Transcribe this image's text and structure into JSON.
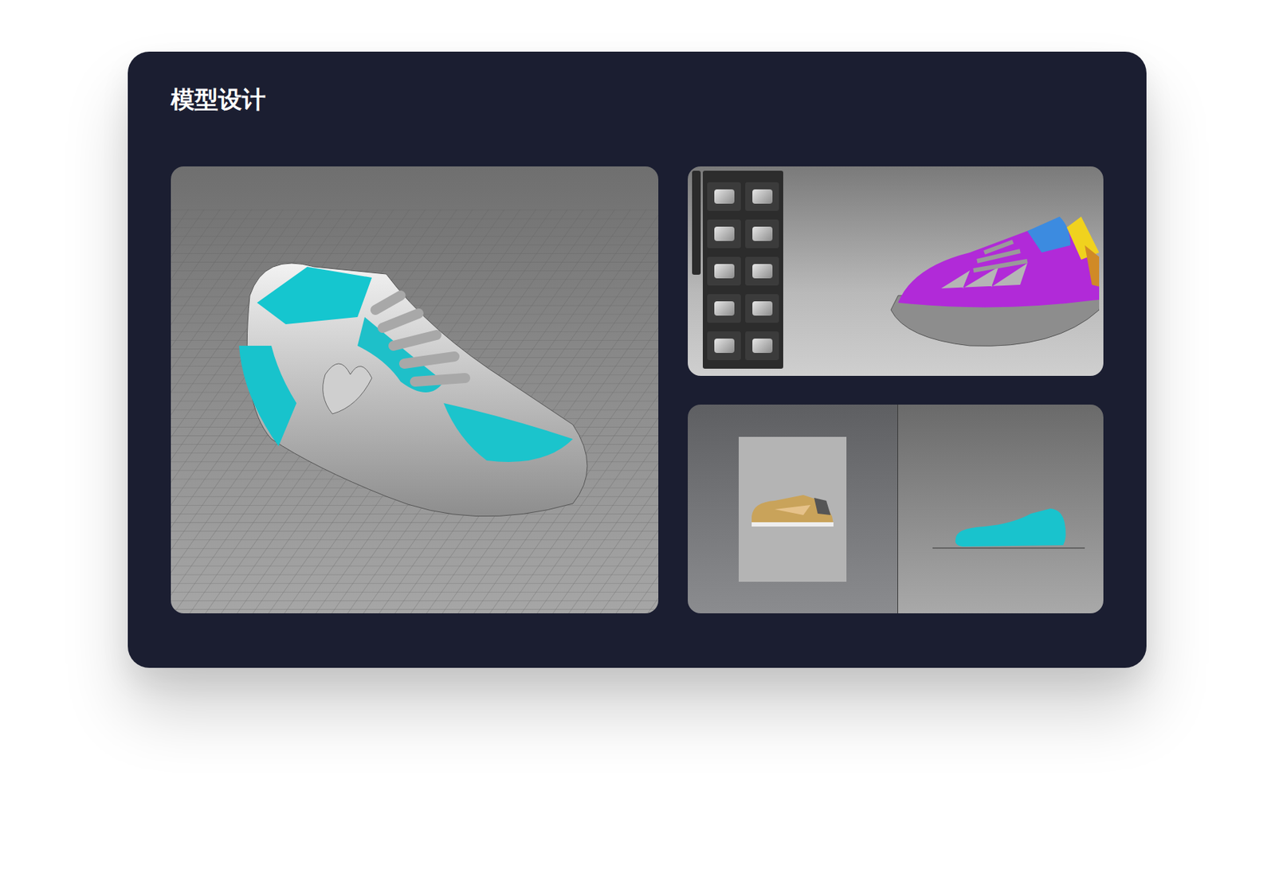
{
  "section": {
    "title": "模型设计"
  }
}
